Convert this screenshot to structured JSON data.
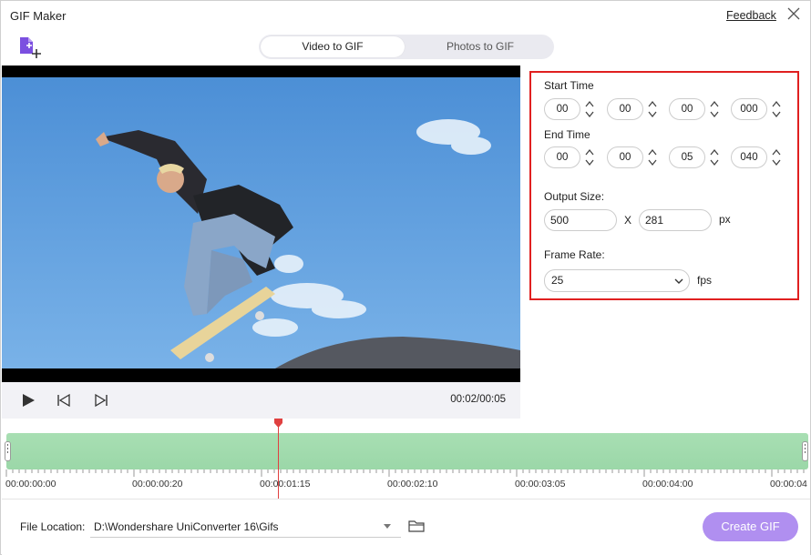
{
  "app": {
    "title": "GIF Maker",
    "feedback": "Feedback"
  },
  "tabs": [
    {
      "label": "Video to GIF",
      "active": true
    },
    {
      "label": "Photos to GIF",
      "active": false
    }
  ],
  "player": {
    "timecode": "00:02/00:05"
  },
  "settings": {
    "start_time_label": "Start Time",
    "start_time": [
      "00",
      "00",
      "00",
      "000"
    ],
    "end_time_label": "End Time",
    "end_time": [
      "00",
      "00",
      "05",
      "040"
    ],
    "output_size_label": "Output Size:",
    "width": "500",
    "x_label": "X",
    "height": "281",
    "px_label": "px",
    "frame_rate_label": "Frame Rate:",
    "frame_rate": "25",
    "fps_label": "fps"
  },
  "timeline": {
    "labels": [
      "00:00:00:00",
      "00:00:00:20",
      "00:00:01:15",
      "00:00:02:10",
      "00:00:03:05",
      "00:00:04:00",
      "00:00:04"
    ]
  },
  "footer": {
    "file_location_label": "File Location:",
    "file_location": "D:\\Wondershare UniConverter 16\\Gifs",
    "create_button": "Create GIF"
  },
  "colors": {
    "accent": "#b08ff0",
    "highlight_border": "#e02020",
    "timeline_track": "#a8dfb3",
    "playhead": "#e04040"
  }
}
